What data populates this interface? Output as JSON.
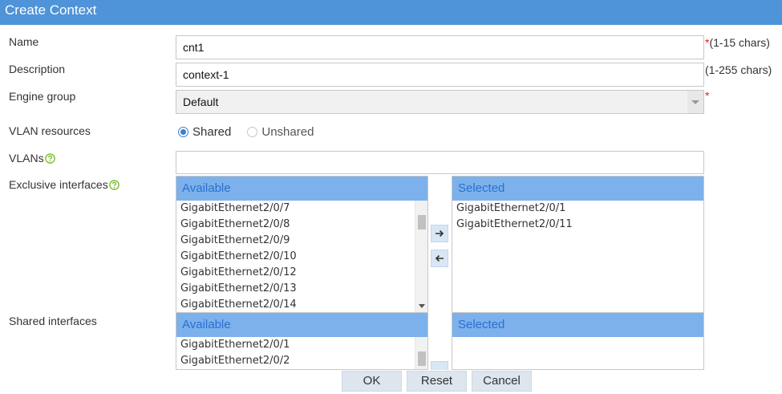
{
  "dialog": {
    "title": "Create Context"
  },
  "form": {
    "name": {
      "label": "Name",
      "value": "cnt1",
      "required": "*",
      "hint": "(1-15 chars)"
    },
    "description": {
      "label": "Description",
      "value": "context-1",
      "hint": "(1-255 chars)"
    },
    "engine_group": {
      "label": "Engine group",
      "value": "Default",
      "required": "*"
    },
    "vlan_resources": {
      "label": "VLAN resources",
      "options": [
        "Shared",
        "Unshared"
      ],
      "selected": "Shared"
    },
    "vlans": {
      "label": "VLANs",
      "value": ""
    },
    "exclusive_interfaces": {
      "label": "Exclusive interfaces",
      "available_header": "Available",
      "selected_header": "Selected",
      "available": [
        "GigabitEthernet2/0/7",
        "GigabitEthernet2/0/8",
        "GigabitEthernet2/0/9",
        "GigabitEthernet2/0/10",
        "GigabitEthernet2/0/12",
        "GigabitEthernet2/0/13",
        "GigabitEthernet2/0/14"
      ],
      "selected": [
        "GigabitEthernet2/0/1",
        "GigabitEthernet2/0/11"
      ]
    },
    "shared_interfaces": {
      "label": "Shared interfaces",
      "available_header": "Available",
      "selected_header": "Selected",
      "available": [
        "GigabitEthernet2/0/1",
        "GigabitEthernet2/0/2"
      ],
      "selected": []
    }
  },
  "buttons": {
    "ok": "OK",
    "reset": "Reset",
    "cancel": "Cancel"
  },
  "colors": {
    "titlebar": "#4f93d9",
    "panel_header": "#7cb1ec",
    "required": "#e02020",
    "help_icon": "#7cbf2e"
  }
}
